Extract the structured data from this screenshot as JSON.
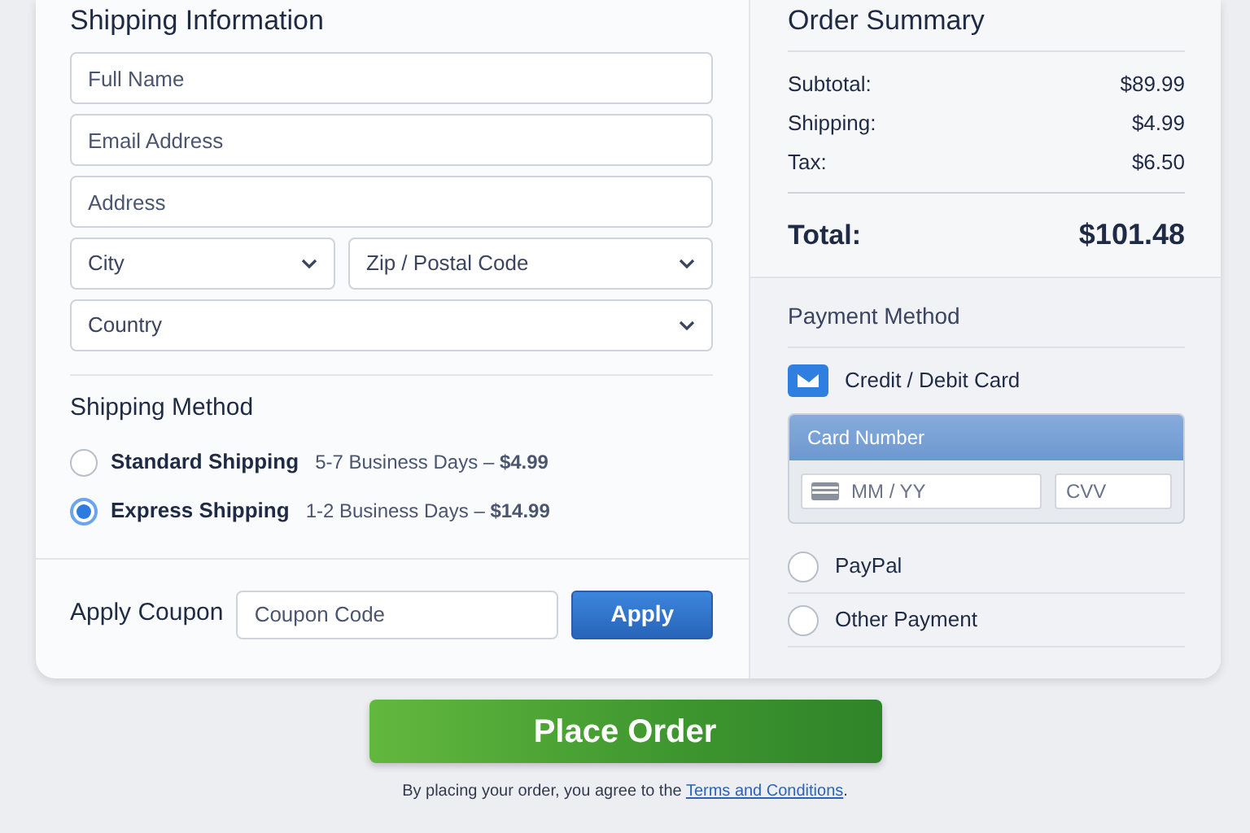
{
  "shipping_information": {
    "title": "Shipping Information",
    "field_rows": [
      [
        {
          "kind": "text",
          "placeholder": "Full Name"
        }
      ],
      [
        {
          "kind": "text",
          "placeholder": "Email Address"
        }
      ],
      [
        {
          "kind": "text",
          "placeholder": "Address"
        }
      ],
      [
        {
          "kind": "select",
          "placeholder": "City"
        },
        {
          "kind": "select",
          "placeholder": "Zip / Postal Code"
        }
      ],
      [
        {
          "kind": "select",
          "placeholder": "Country"
        }
      ]
    ]
  },
  "shipping_method": {
    "title": "Shipping Method",
    "options": [
      {
        "label": "Standard Shipping",
        "detail": "5-7 Business Days – **$4.99**",
        "selected": false
      },
      {
        "label": "Express Shipping",
        "detail": "1-2 Business Days – **$14.99**",
        "selected": true
      }
    ]
  },
  "coupon": {
    "label": "Apply Coupon",
    "placeholder": "Coupon Code",
    "button": "Apply"
  },
  "order_summary": {
    "title": "Order Summary",
    "lines": [
      {
        "label": "Subtotal:",
        "value": "$89.99"
      },
      {
        "label": "Shipping:",
        "value": "$4.99"
      },
      {
        "label": "Tax:",
        "value": "$6.50"
      }
    ],
    "total": {
      "label": "Total:",
      "value": "$101.48"
    }
  },
  "payment_method": {
    "title": "Payment Method",
    "methods": [
      {
        "label": "Credit / Debit Card",
        "selected": true,
        "card_form": {
          "header": "Card Number",
          "expiry_placeholder": "MM / YY",
          "cvv_placeholder": "CVV"
        }
      },
      {
        "label": "PayPal",
        "selected": false
      },
      {
        "label": "Other Payment",
        "selected": false
      }
    ]
  },
  "place_order": {
    "button": "Place Order",
    "agreement": "By placing your order, you agree to the",
    "link": "Terms and Conditions",
    "end": "."
  }
}
